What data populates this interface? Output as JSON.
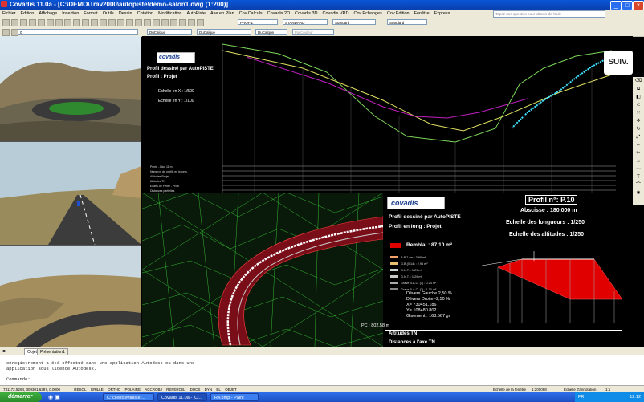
{
  "window": {
    "title": "Covadis 11.0a - [C:\\DEMO\\Trav2000\\autopiste\\demo-salon1.dwg (1:200)]"
  },
  "menu": [
    "Fichier",
    "Edition",
    "Affichage",
    "Insertion",
    "Format",
    "Outils",
    "Dessin",
    "Cotation",
    "Modification",
    "AutoPiste",
    "Axe en Plan",
    "Cov.Calculs",
    "Covadis 2D",
    "Covadis 3D",
    "Covadis VRD",
    "Cov.Echanges",
    "Cov.Edition",
    "Fenêtre",
    "Express"
  ],
  "help_search_placeholder": "Tapez une question pour obtenir de l'aide",
  "toolbars": {
    "layer": "0",
    "color": "DuCalque",
    "linetype": "DuCalque",
    "lineweight": "DuCalque",
    "plotstyle": "ParCouleur",
    "profil": "PROFIL",
    "standard1": "STANDARD",
    "standard2": "Standard",
    "standard3": "Standard"
  },
  "suiv_label": "SUIV.",
  "long_profile": {
    "logo": "covadis",
    "title": "Profil dessiné par AutoPISTE",
    "subtitle": "Profil : Projet",
    "scale_x": "Echelle en X : 1/500",
    "scale_y": "Echelle en Y : 1/100",
    "table_rows": [
      "Pente - Bloc 11 m",
      "Numéros de profils en travers",
      "Altitudes Projet",
      "Altitudes TN",
      "Ecarts de Pente - Profil",
      "Distances partielles"
    ]
  },
  "cross_profile": {
    "logo": "covadis",
    "title": "Profil dessiné par AutoPISTE",
    "subtitle": "Profil en long : Projet",
    "profile_number": "Profil n°: P.10",
    "abscisse": "Abscisse : 180,000 m",
    "echelle_longueurs": "Echelle des longueurs : 1/250",
    "echelle_altitudes": "Echelle des altitudes : 1/250",
    "remblai": "Remblai : 87,10 m²",
    "legend": [
      "B.B 7 cm : 3.98 m²",
      "G.B.(0/14) : 2.96 m²",
      "G.N.T. : 1.29 m²",
      "G.N.T. : 1.29 m²",
      "Grave B.A.O. (1) : 0.24 m²",
      "Grave B.A.O. (2) : 1.30 m²"
    ],
    "devers_gauche": "Dévers Gauche 2,50 %",
    "devers_droite": "Dévers Droite -2,50 %",
    "x": "X= 730451.186",
    "y": "Y= 108480.802",
    "gisement": "Gisement : 163.567 gr",
    "pc": "PC : 802,58 m",
    "row_alt": "Altitudes TN",
    "row_dist": "Distances à l'axe TN"
  },
  "tabs": [
    "Objet",
    "Présentation1"
  ],
  "command": {
    "lines": [
      "enregistrement a été effectué dans une application Autodesk ou dans une",
      "application sous licence Autodesk."
    ],
    "prompt": "Commande:"
  },
  "status": {
    "coords": "731172.5264, 309301.6397, 0.0000",
    "buttons": [
      "RESOL",
      "GRILLE",
      "ORTHO",
      "POLAIRE",
      "ACCROBJ",
      "REPEROBJ",
      "DUCS",
      "DYN",
      "EL",
      "OBJET"
    ],
    "scale_label": "Echelle de la fenêtre",
    "scale_value": "1:200068",
    "annot_label": "Echelle d'annotation",
    "annot_value": "1:1"
  },
  "taskbar": {
    "start": "démarrer",
    "items": [
      "C:\\clients\\Minister...",
      "Covadis 11.0a - [C:...",
      "R4.bmp - Paint"
    ],
    "lang": "FR",
    "clock": "12:12"
  },
  "colors": {
    "title_blue": "#0a56d8",
    "menu_bg": "#ece9d8",
    "start_green": "#3fae3f",
    "remblai": "#e00000",
    "profile_cyan": "#40e0ff"
  }
}
